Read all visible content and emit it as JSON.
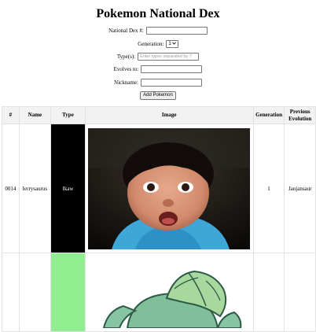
{
  "page": {
    "title": "Pokemon National Dex"
  },
  "form": {
    "dex_label": "National Dex #:",
    "dex_value": "",
    "generation_label": "Generation:",
    "generation_value": "1",
    "types_label": "Type(s):",
    "types_placeholder": "Enter types separated by '/'",
    "evolves_label": "Evolves to:",
    "evolves_value": "",
    "nickname_label": "Nickname:",
    "nickname_value": "",
    "add_button": "Add Pokemon"
  },
  "table": {
    "headers": [
      "#",
      "Name",
      "Type",
      "Image",
      "Generation",
      "Previous Evolution"
    ],
    "rows": [
      {
        "number": "0014",
        "name": "Ierrysaurus",
        "type": "Ikaw",
        "type_color": "#000000",
        "image": "child-photo",
        "generation": "1",
        "previous_evolution": "Janjansaur"
      },
      {
        "number": "",
        "name": "",
        "type": "",
        "type_color": "#90ee90",
        "image": "bulbasaur",
        "generation": "",
        "previous_evolution": ""
      }
    ]
  },
  "icons": {
    "select_arrow": "chevron-down-icon"
  }
}
